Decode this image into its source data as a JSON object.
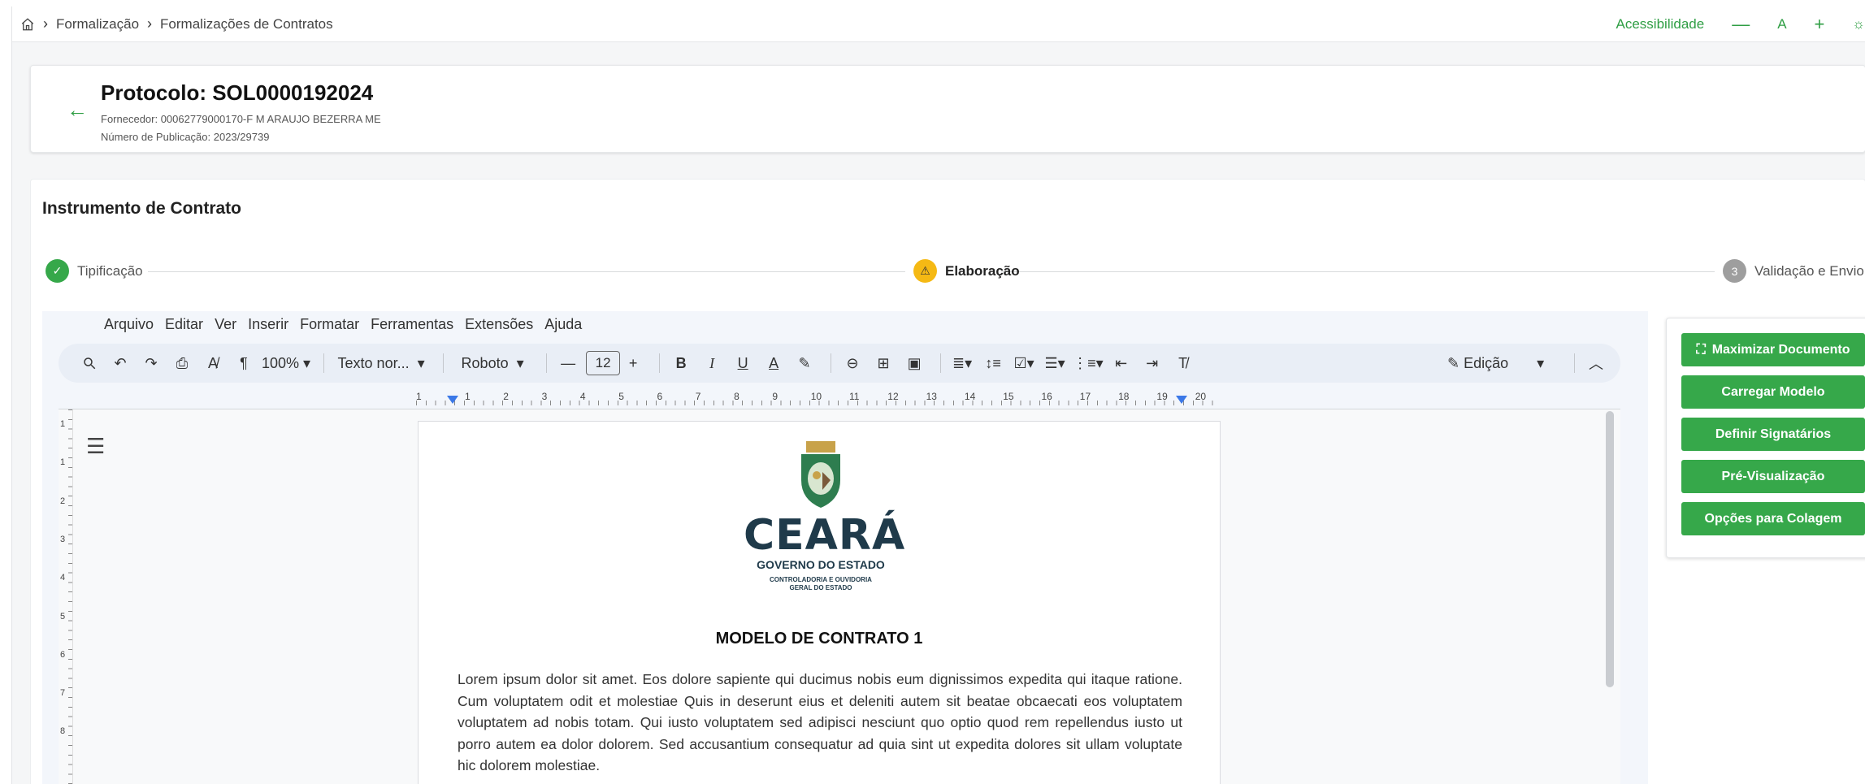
{
  "breadcrumb": {
    "items": [
      "Formalização",
      "Formalizações de Contratos"
    ]
  },
  "accessibility": {
    "label": "Acessibilidade",
    "decrease": "—",
    "reset": "A",
    "increase": "+"
  },
  "header": {
    "title": "Protocolo: SOL0000192024",
    "supplier": "Fornecedor: 00062779000170-F M ARAUJO BEZERRA ME",
    "publication": "Número de Publicação: 2023/29739"
  },
  "section": {
    "title": "Instrumento de Contrato"
  },
  "stepper": {
    "steps": [
      {
        "label": "Tipificação",
        "status": "done"
      },
      {
        "label": "Elaboração",
        "status": "warning"
      },
      {
        "label": "Validação e Envio",
        "number": "3",
        "status": "pending"
      }
    ]
  },
  "editor": {
    "menu": [
      "Arquivo",
      "Editar",
      "Ver",
      "Inserir",
      "Formatar",
      "Ferramentas",
      "Extensões",
      "Ajuda"
    ],
    "zoom": "100%",
    "style": "Texto nor...",
    "font": "Roboto",
    "font_size": "12",
    "mode": "Edição",
    "ruler_numbers": [
      "1",
      "1",
      "2",
      "3",
      "4",
      "5",
      "6",
      "7",
      "8",
      "9",
      "10",
      "11",
      "12",
      "13",
      "14",
      "15",
      "16",
      "17",
      "18",
      "19",
      "20"
    ],
    "vruler_numbers": [
      "1",
      "1",
      "2",
      "3",
      "4",
      "5",
      "6",
      "7",
      "8"
    ]
  },
  "document": {
    "logo_main": "CEARÁ",
    "logo_sub": "GOVERNO DO ESTADO",
    "logo_sub2_line1": "CONTROLADORIA E OUVIDORIA",
    "logo_sub2_line2": "GERAL DO ESTADO",
    "title": "MODELO DE CONTRATO 1",
    "body": "Lorem ipsum dolor sit amet. Eos dolore sapiente qui ducimus nobis eum dignissimos expedita qui itaque ratione. Cum voluptatem odit et molestiae Quis in deserunt eius et deleniti autem sit beatae obcaecati eos voluptatem voluptatem ad nobis totam. Qui iusto voluptatem sed adipisci nesciunt quo optio quod rem repellendus iusto ut porro autem ea dolor dolorem. Sed accusantium consequatur ad quia sint ut expedita dolores sit ullam voluptate hic dolorem molestiae."
  },
  "actions": {
    "maximize": "Maximizar Documento",
    "load_template": "Carregar Modelo",
    "signatories": "Definir Signatários",
    "preview": "Pré-Visualização",
    "paste_options": "Opções para Colagem"
  },
  "colors": {
    "accent": "#36a84a",
    "warning": "#f5b914",
    "pending": "#9e9e9e"
  }
}
